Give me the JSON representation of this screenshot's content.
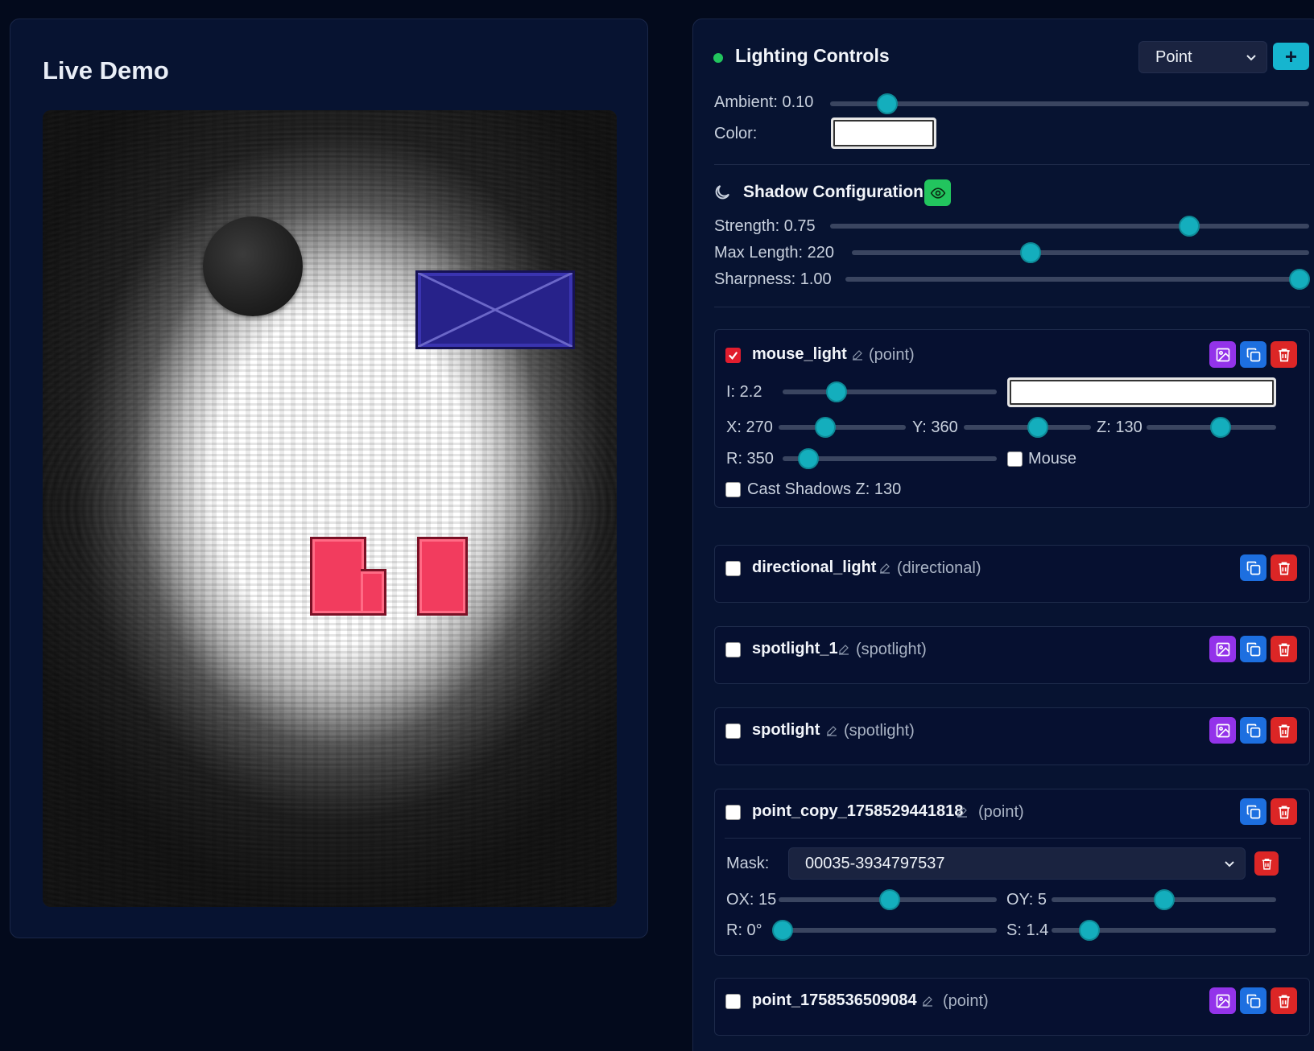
{
  "demo": {
    "title": "Live Demo"
  },
  "lighting": {
    "title": "Lighting Controls",
    "type_select": "Point",
    "add_label": "+",
    "ambient": {
      "label": "Ambient: 0.10",
      "value": 0.1
    },
    "color_label": "Color:",
    "color_value": "#ffffff"
  },
  "shadow": {
    "title": "Shadow Configuration",
    "strength": {
      "label": "Strength: 0.75",
      "value": 0.75
    },
    "max_length": {
      "label": "Max Length: 220",
      "value": 220
    },
    "sharpness": {
      "label": "Sharpness: 1.00",
      "value": 1.0
    }
  },
  "lights": [
    {
      "name": "mouse_light",
      "type": "(point)",
      "enabled": true,
      "intensity": {
        "label": "I: 2.2",
        "value": 2.2
      },
      "x": {
        "label": "X: 270",
        "value": 270
      },
      "y": {
        "label": "Y: 360",
        "value": 360
      },
      "z": {
        "label": "Z: 130",
        "value": 130
      },
      "r": {
        "label": "R: 350",
        "value": 350
      },
      "mouse_label": "Mouse",
      "cast_shadows_label": "Cast Shadows Z: 130"
    },
    {
      "name": "directional_light",
      "type": "(directional)",
      "enabled": false
    },
    {
      "name": "spotlight_1",
      "type": "(spotlight)",
      "enabled": false
    },
    {
      "name": "spotlight",
      "type": "(spotlight)",
      "enabled": false
    },
    {
      "name": "point_copy_1758529441818",
      "type": "(point)",
      "enabled": false,
      "mask_label": "Mask:",
      "mask_value": "00035-3934797537",
      "ox": {
        "label": "OX: 15",
        "value": 15
      },
      "oy": {
        "label": "OY: 5",
        "value": 5
      },
      "r": {
        "label": "R: 0°",
        "value": 0
      },
      "s": {
        "label": "S: 1.4",
        "value": 1.4
      }
    },
    {
      "name": "point_1758536509084",
      "type": "(point)",
      "enabled": false
    }
  ],
  "colors": {
    "accent": "#14aebd",
    "danger": "#dc2626",
    "copy": "#1d6fe0",
    "image": "#9333ea",
    "status": "#22c55e"
  }
}
